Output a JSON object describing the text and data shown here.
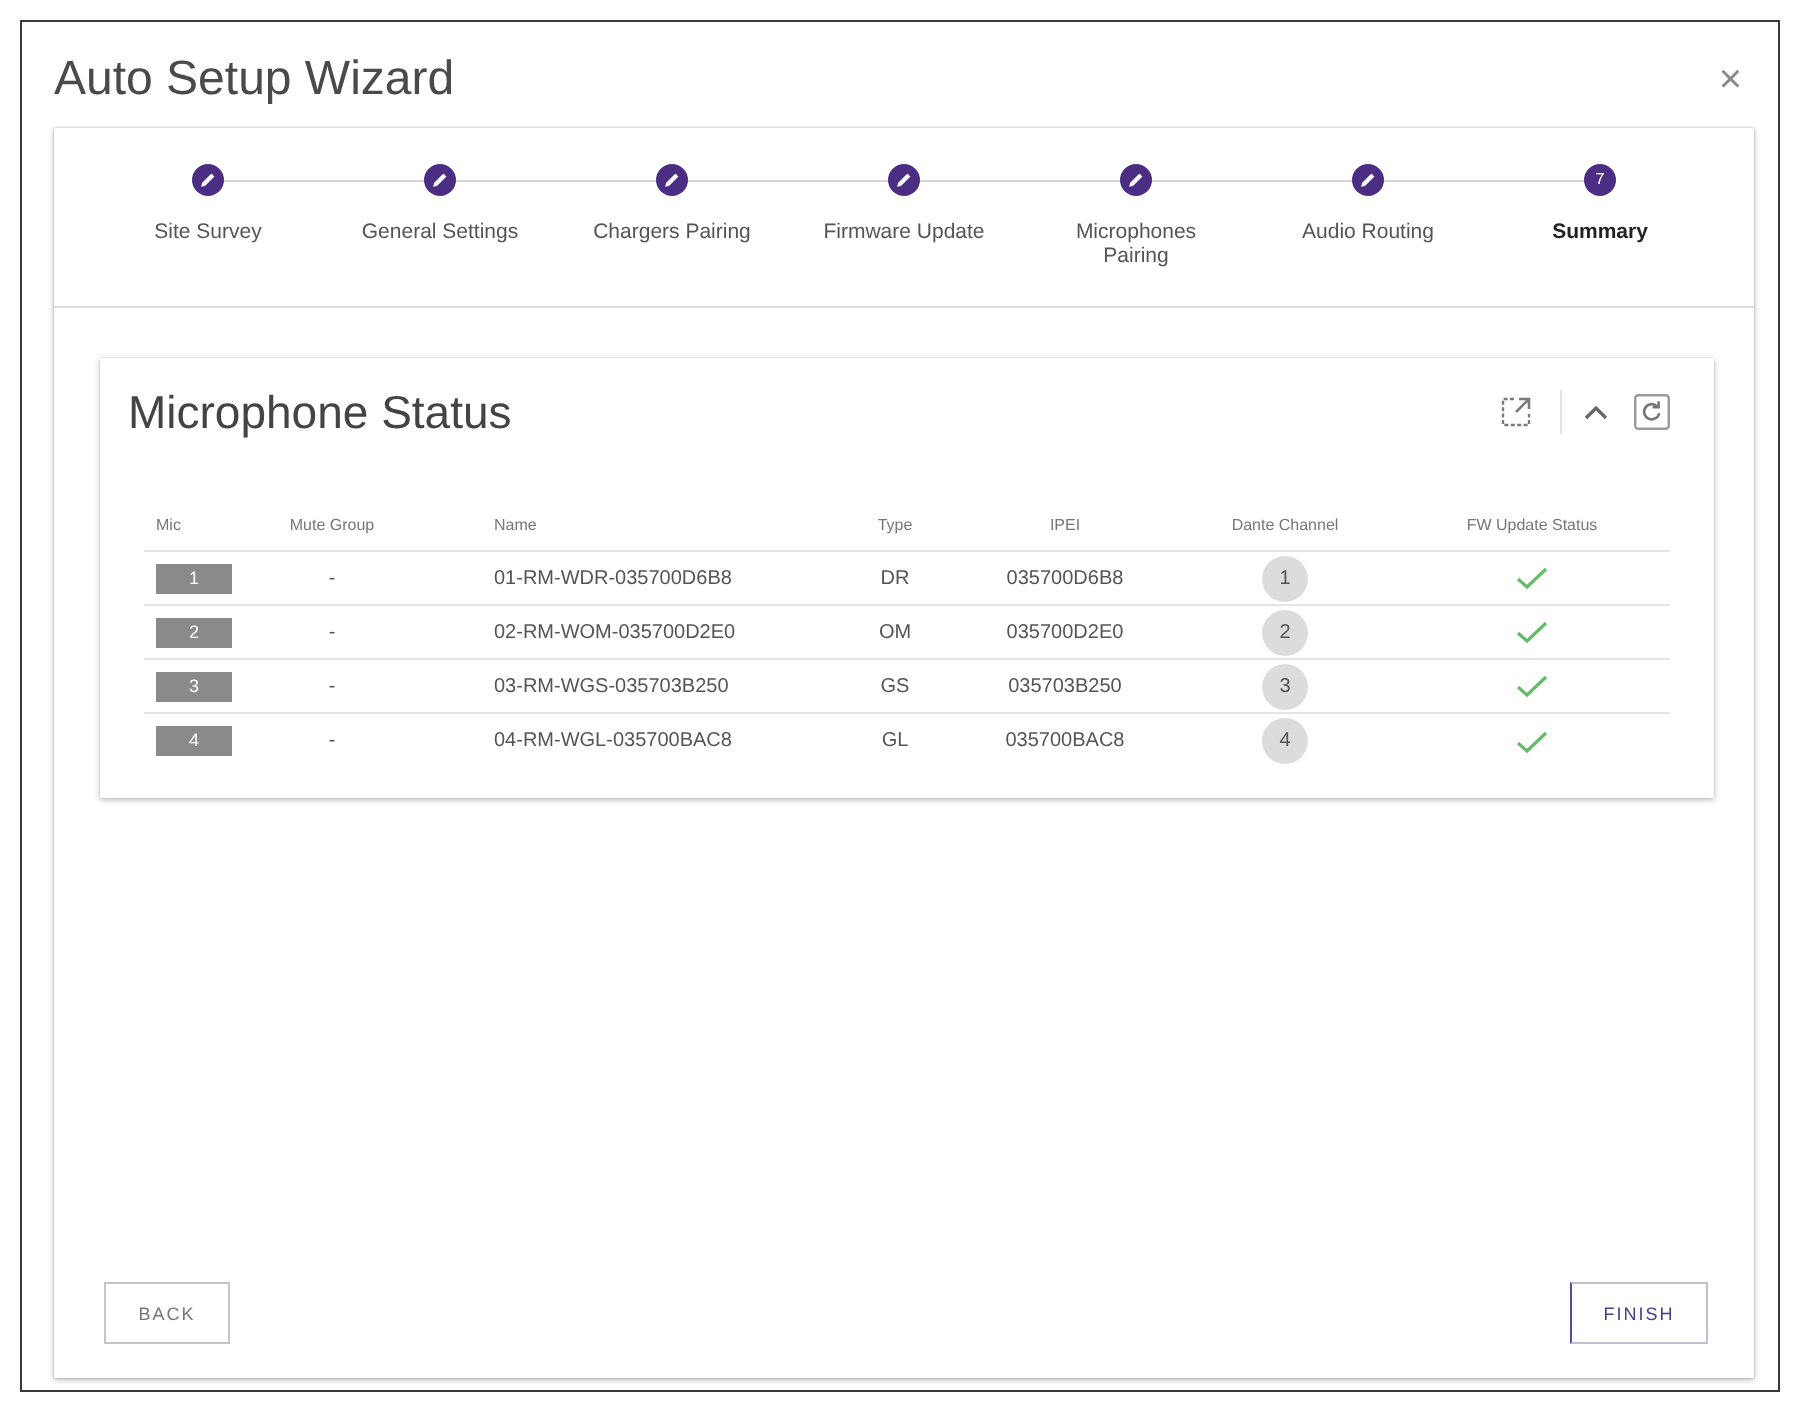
{
  "dialog": {
    "title": "Auto Setup Wizard",
    "close_label": "×"
  },
  "steps": [
    {
      "label": "Site Survey",
      "completed": true,
      "selected": false
    },
    {
      "label": "General Settings",
      "completed": true,
      "selected": false
    },
    {
      "label": "Chargers Pairing",
      "completed": true,
      "selected": false
    },
    {
      "label": "Firmware Update",
      "completed": true,
      "selected": false
    },
    {
      "label": "Microphones Pairing",
      "completed": true,
      "selected": false
    },
    {
      "label": "Audio Routing",
      "completed": true,
      "selected": false
    },
    {
      "label": "Summary",
      "number": "7",
      "completed": false,
      "selected": true
    }
  ],
  "status_card": {
    "title": "Microphone Status",
    "columns": [
      "Mic",
      "Mute Group",
      "Name",
      "Type",
      "IPEI",
      "Dante Channel",
      "FW Update Status"
    ],
    "rows": [
      {
        "mic": "1",
        "mute_group": "-",
        "name": "01-RM-WDR-035700D6B8",
        "type": "DR",
        "ipei": "035700D6B8",
        "dante_channel": "1",
        "fw_updated": true
      },
      {
        "mic": "2",
        "mute_group": "-",
        "name": "02-RM-WOM-035700D2E0",
        "type": "OM",
        "ipei": "035700D2E0",
        "dante_channel": "2",
        "fw_updated": true
      },
      {
        "mic": "3",
        "mute_group": "-",
        "name": "03-RM-WGS-035703B250",
        "type": "GS",
        "ipei": "035703B250",
        "dante_channel": "3",
        "fw_updated": true
      },
      {
        "mic": "4",
        "mute_group": "-",
        "name": "04-RM-WGL-035700BAC8",
        "type": "GL",
        "ipei": "035700BAC8",
        "dante_channel": "4",
        "fw_updated": true
      }
    ]
  },
  "buttons": [
    {
      "label": "BACK",
      "kind": "back"
    },
    {
      "label": "FINISH",
      "kind": "finish"
    }
  ]
}
